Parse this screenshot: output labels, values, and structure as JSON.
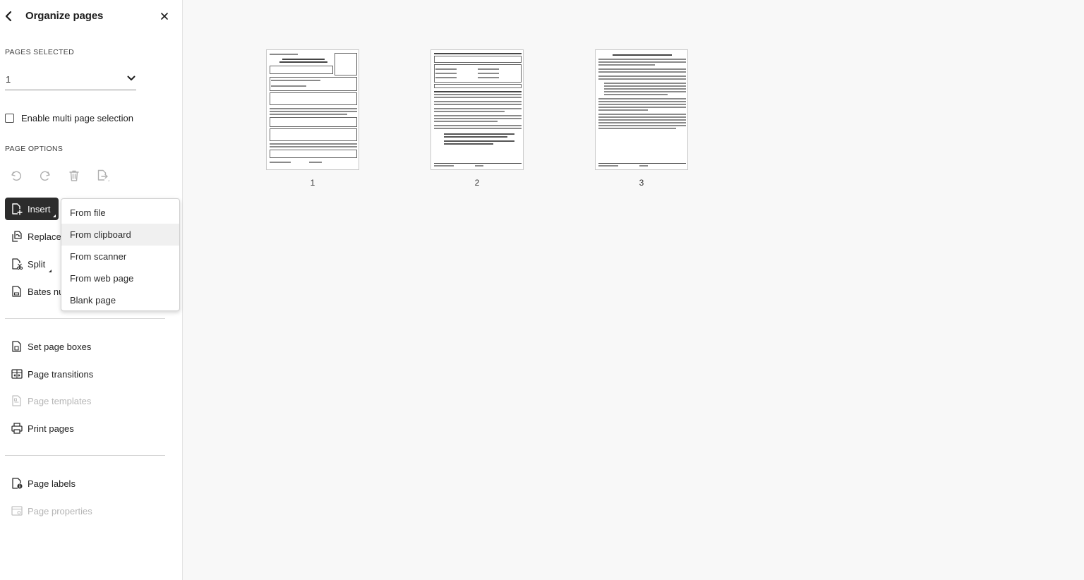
{
  "panel": {
    "title": "Organize pages",
    "pages_selected_label": "PAGES SELECTED",
    "pages_selected_value": "1",
    "multi_page_label": "Enable multi page selection",
    "page_options_label": "PAGE OPTIONS"
  },
  "tools": {
    "undo_icon": "undo-icon",
    "redo_icon": "redo-icon",
    "delete_icon": "trash-icon",
    "extract_icon": "extract-icon"
  },
  "actions": {
    "insert": "Insert",
    "replace": "Replace",
    "split": "Split",
    "bates": "Bates nu",
    "set_page_boxes": "Set page boxes",
    "page_transitions": "Page transitions",
    "page_templates": "Page templates",
    "print_pages": "Print pages",
    "page_labels": "Page labels",
    "page_properties": "Page properties"
  },
  "insert_menu": {
    "items": [
      "From file",
      "From clipboard",
      "From scanner",
      "From web page",
      "Blank page"
    ],
    "highlighted": "From clipboard"
  },
  "pages": [
    {
      "number": "1"
    },
    {
      "number": "2"
    },
    {
      "number": "3"
    }
  ],
  "colors": {
    "selected_button_bg": "#2c2c2c",
    "canvas_bg": "#f8f8f8",
    "disabled_text": "#b5b5b5"
  }
}
